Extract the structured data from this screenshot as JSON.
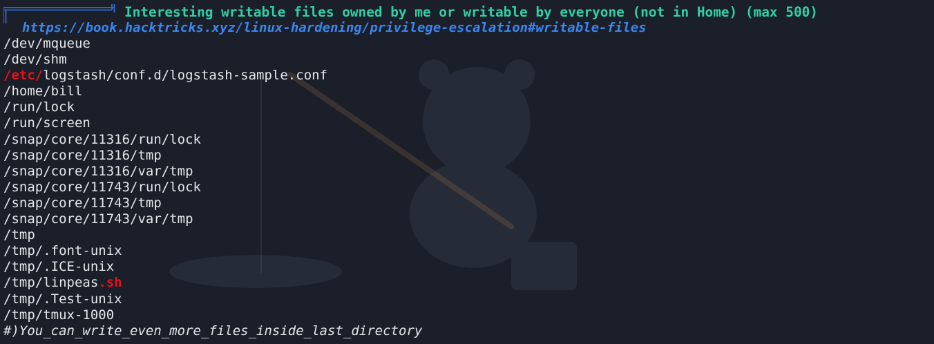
{
  "section": {
    "title": "Interesting writable files owned by me or writable by everyone (not in Home) (max 500)",
    "link": "https://book.hacktricks.xyz/linux-hardening/privilege-escalation#writable-files"
  },
  "highlight_color": "#e8101a",
  "title_color": "#2fd1a6",
  "link_color": "#3a86f0",
  "paths": [
    {
      "pre": "/dev/mqueue",
      "hl": "",
      "post": ""
    },
    {
      "pre": "/dev/shm",
      "hl": "",
      "post": ""
    },
    {
      "pre": "",
      "hl": "/etc/",
      "post": "logstash/conf.d/logstash-sample.conf"
    },
    {
      "pre": "/home/bill",
      "hl": "",
      "post": ""
    },
    {
      "pre": "/run/lock",
      "hl": "",
      "post": ""
    },
    {
      "pre": "/run/screen",
      "hl": "",
      "post": ""
    },
    {
      "pre": "/snap/core/11316/run/lock",
      "hl": "",
      "post": ""
    },
    {
      "pre": "/snap/core/11316/tmp",
      "hl": "",
      "post": ""
    },
    {
      "pre": "/snap/core/11316/var/tmp",
      "hl": "",
      "post": ""
    },
    {
      "pre": "/snap/core/11743/run/lock",
      "hl": "",
      "post": ""
    },
    {
      "pre": "/snap/core/11743/tmp",
      "hl": "",
      "post": ""
    },
    {
      "pre": "/snap/core/11743/var/tmp",
      "hl": "",
      "post": ""
    },
    {
      "pre": "/tmp",
      "hl": "",
      "post": ""
    },
    {
      "pre": "/tmp/.font-unix",
      "hl": "",
      "post": ""
    },
    {
      "pre": "/tmp/.ICE-unix",
      "hl": "",
      "post": ""
    },
    {
      "pre": "/tmp/linpeas",
      "hl": ".sh",
      "post": ""
    },
    {
      "pre": "/tmp/.Test-unix",
      "hl": "",
      "post": ""
    },
    {
      "pre": "/tmp/tmux-1000",
      "hl": "",
      "post": ""
    }
  ],
  "footer": "#)You_can_write_even_more_files_inside_last_directory"
}
